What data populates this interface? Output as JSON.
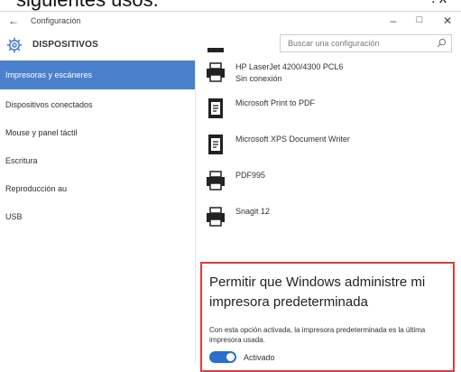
{
  "caption": {
    "text": "siguientes usos.",
    "marks": "  .  x"
  },
  "window": {
    "back_glyph": "←",
    "title": "Configuración",
    "minimize_glyph": "–",
    "maximize_glyph": "□",
    "close_glyph": "✕"
  },
  "header": {
    "section_title": "DISPOSITIVOS",
    "search_placeholder": "Buscar una configuración"
  },
  "sidebar": {
    "items": [
      {
        "label": "Impresoras y escáneres",
        "active": true
      },
      {
        "label": "Dispositivos conectados"
      },
      {
        "label": "Mouse y panel táctil"
      },
      {
        "label": "Escritura"
      },
      {
        "label": "Reproducción au"
      },
      {
        "label": "USB"
      }
    ]
  },
  "printers": [
    {
      "name": "HP LaserJet 4200/4300 PCL6",
      "status": "Sin conexión",
      "icon": "printer-icon"
    },
    {
      "name": "Microsoft Print to PDF",
      "icon": "pdf-document-icon"
    },
    {
      "name": "Microsoft XPS Document Writer",
      "icon": "xps-document-icon"
    },
    {
      "name": "PDF995",
      "icon": "printer-icon"
    },
    {
      "name": "Snagit 12",
      "icon": "printer-icon"
    }
  ],
  "default_printer_setting": {
    "title": "Permitir que Windows administre mi impresora predeterminada",
    "description": "Con esta opción activada, la impresora predeterminada es la última impresora usada.",
    "toggle_state": "on",
    "toggle_label": "Activado",
    "toggle_color": "#2a6fc9",
    "highlight_border_color": "#e03a3a"
  },
  "colors": {
    "accent_active_nav": "#4a80cc"
  }
}
